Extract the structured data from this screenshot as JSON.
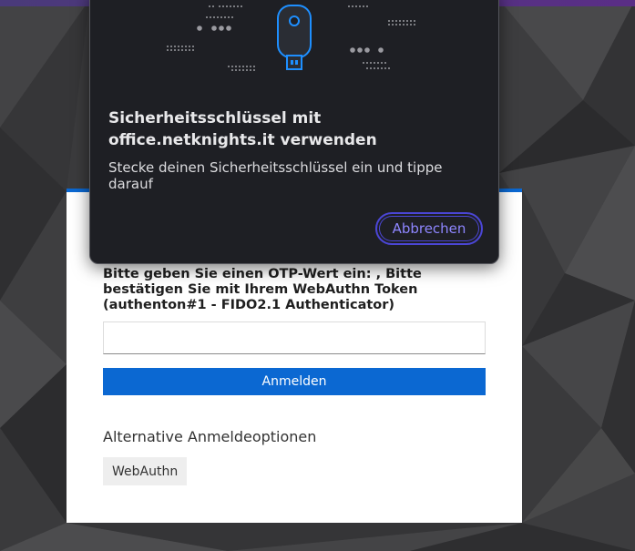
{
  "dialog": {
    "title": "Sicherheitsschlüssel mit office.netknights.it verwenden",
    "description": "Stecke deinen Sicherheitsschlüssel ein und tippe darauf",
    "cancel_label": "Abbrechen",
    "illustration_icon": "usb-security-key-icon"
  },
  "login": {
    "otp_label": "Bitte geben Sie einen OTP-Wert ein: , Bitte bestätigen Sie mit Ihrem WebAuthn Token (authenton#1 - FIDO2.1 Authenticator)",
    "otp_value": "",
    "login_button_label": "Anmelden",
    "alt_heading": "Alternative Anmeldeoptionen",
    "alt_options": [
      "WebAuthn"
    ]
  },
  "colors": {
    "primary": "#0b68d2",
    "dialog_bg": "#1e1f24",
    "dialog_accent": "#4b46d6",
    "key_blue": "#1e8fff"
  }
}
